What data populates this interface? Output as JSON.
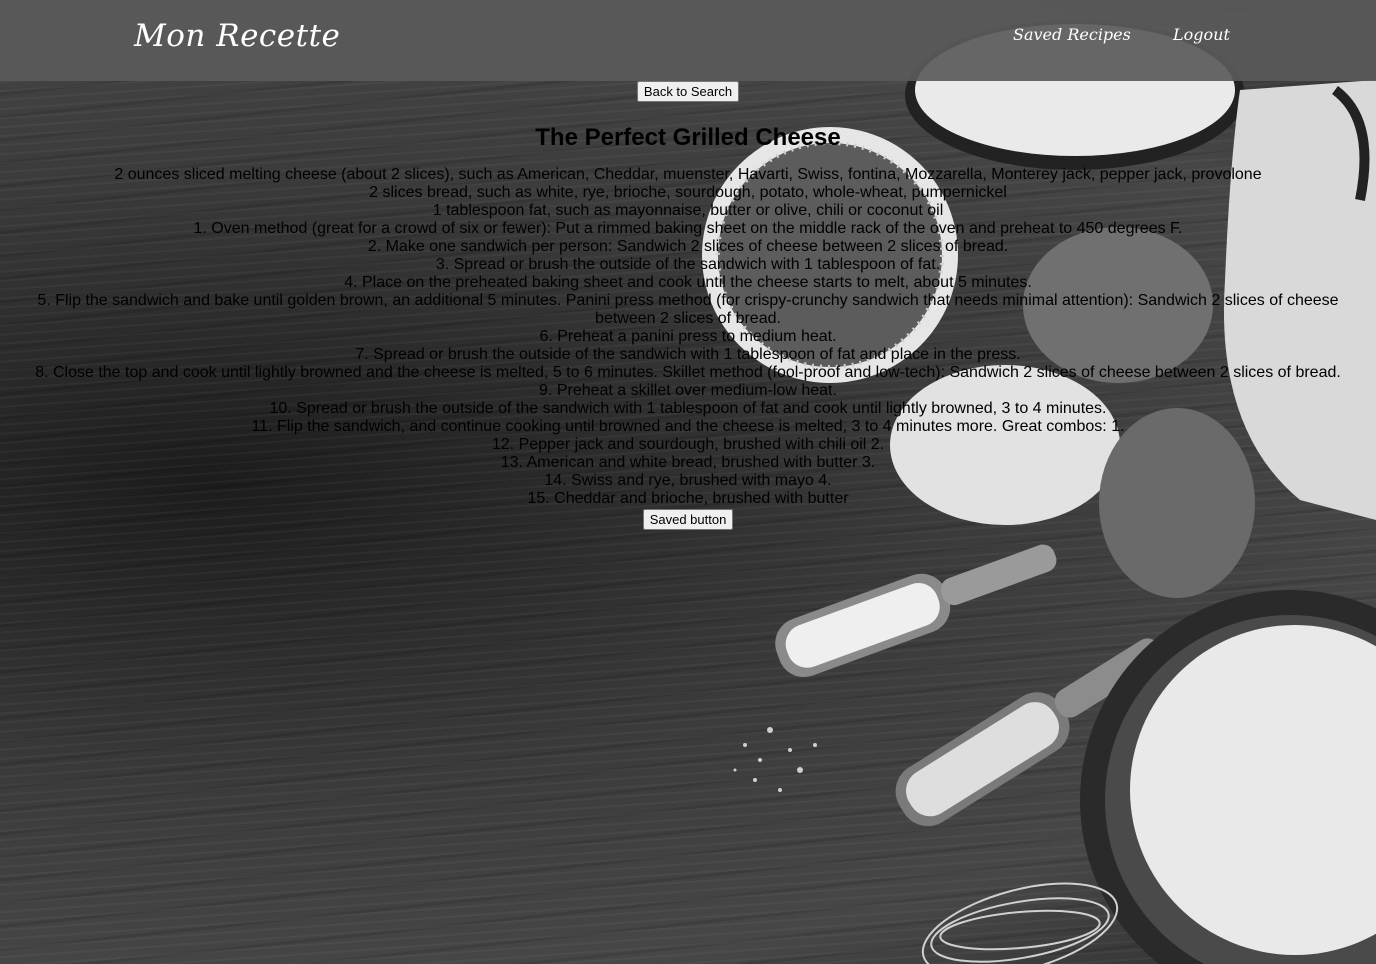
{
  "header": {
    "brand": "Mon Recette",
    "nav": [
      {
        "label": "Saved Recipes"
      },
      {
        "label": "Logout"
      }
    ]
  },
  "main": {
    "back_button": "Back to Search",
    "title": "The Perfect Grilled Cheese",
    "ingredients": [
      "2 ounces sliced melting cheese (about 2 slices), such as American, Cheddar, muenster, Havarti, Swiss, fontina, Mozzarella, Monterey jack, pepper jack, provolone",
      "2 slices bread, such as white, rye, brioche, sourdough, potato, whole-wheat, pumpernickel",
      "1 tablespoon fat, such as mayonnaise, butter or olive, chili or coconut oil"
    ],
    "steps": [
      "1. Oven method (great for a crowd of six or fewer): Put a rimmed baking sheet on the middle rack of the oven and preheat to 450 degrees F.",
      "2. Make one sandwich per person: Sandwich 2 slices of cheese between 2 slices of bread.",
      "3. Spread or brush the outside of the sandwich with 1 tablespoon of fat.",
      "4. Place on the preheated baking sheet and cook until the cheese starts to melt, about 5 minutes.",
      "5. Flip the sandwich and bake until golden brown, an additional 5 minutes. Panini press method (for crispy-crunchy sandwich that needs minimal attention): Sandwich 2 slices of cheese between 2 slices of bread.",
      "6. Preheat a panini press to medium heat.",
      "7. Spread or brush the outside of the sandwich with 1 tablespoon of fat and place in the press.",
      "8. Close the top and cook until lightly browned and the cheese is melted, 5 to 6 minutes.  Skillet method (fool-proof and low-tech): Sandwich 2 slices of cheese between 2 slices of bread.",
      "9. Preheat a skillet over medium-low heat.",
      "10. Spread or brush the outside of the sandwich with 1 tablespoon of fat and cook until lightly browned, 3 to 4 minutes.",
      "11. Flip the sandwich, and continue cooking until browned and the cheese is melted, 3 to 4 minutes more. Great combos: 1.",
      "12. Pepper jack and sourdough, brushed with chili oil  2.",
      "13. American and white bread, brushed with butter 3.",
      "14. Swiss and rye, brushed with mayo  4.",
      "15. Cheddar and brioche, brushed with butter"
    ],
    "save_button": "Saved button"
  },
  "colors": {
    "header_bg": "#5a5a5a",
    "nav_text": "#ffffff",
    "body_text": "#000000",
    "button_bg": "#efefef"
  },
  "icons": {
    "background": "kitchen-ingredients-photo"
  }
}
